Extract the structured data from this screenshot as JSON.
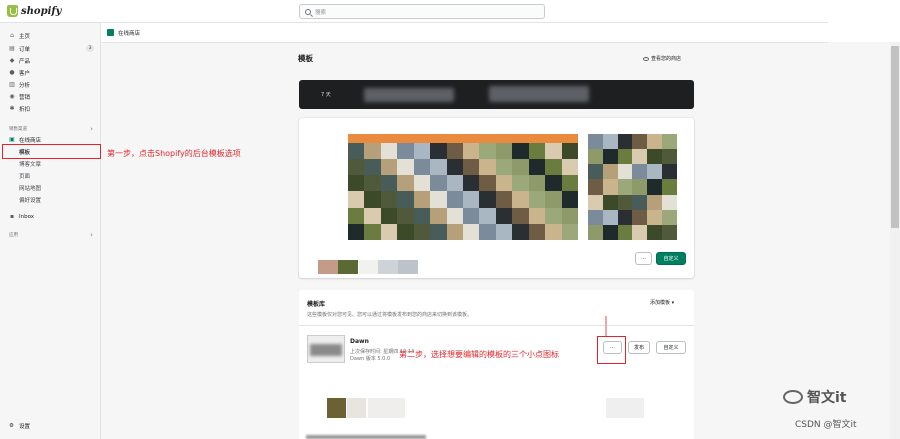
{
  "app": {
    "brand": "shopify"
  },
  "search": {
    "placeholder": "搜索"
  },
  "sidebar": {
    "items": [
      {
        "label": "主页",
        "icon": "home-icon"
      },
      {
        "label": "订单",
        "icon": "orders-icon",
        "badge": "3"
      },
      {
        "label": "产品",
        "icon": "tag-icon"
      },
      {
        "label": "客户",
        "icon": "person-icon"
      },
      {
        "label": "分析",
        "icon": "analytics-icon"
      },
      {
        "label": "营销",
        "icon": "marketing-icon"
      },
      {
        "label": "折扣",
        "icon": "discount-icon"
      }
    ],
    "channels_label": "销售渠道",
    "online_store": "在线商店",
    "subitems": [
      "模板",
      "博客文章",
      "页面",
      "网站地图",
      "偏好设置"
    ],
    "inbox": "Inbox",
    "apps_label": "应用",
    "settings": "设置"
  },
  "breadcrumb": {
    "label": "在线商店"
  },
  "main": {
    "title": "模板",
    "view_store": "查看您的商店",
    "banner_days": "7 天",
    "customize": "自定义",
    "more": "···"
  },
  "library": {
    "title": "模板库",
    "description": "这些模板仅对您可见。您可以通过将模板发布到您的商店来切换到该模板。",
    "add_theme": "添加模板",
    "theme_name": "Dawn",
    "last_saved": "上次保存时间: 星期四 12:13",
    "version": "Dawn 版本 5.0.0",
    "publish": "发布",
    "customize": "自定义",
    "more": "···"
  },
  "annotations": {
    "step1": "第一步，点击Shopify的后台模板选项",
    "step2": "第二步，选择想要编辑的模板的三个小点图标"
  },
  "watermark": {
    "brand": "智文it",
    "csdn": "CSDN @智文it"
  },
  "colors": {
    "accent": "#008060",
    "annotation": "#e0262b",
    "brand_green": "#95bf47",
    "banner": "#1e1f21",
    "orange": "#e98a3f"
  }
}
